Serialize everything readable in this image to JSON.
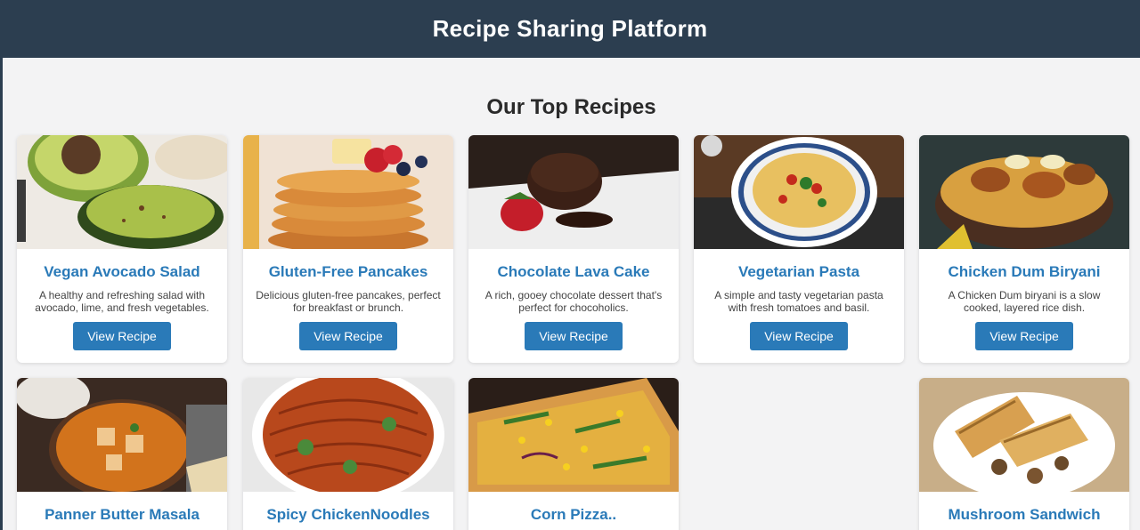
{
  "header": {
    "title": "Recipe Sharing Platform"
  },
  "section": {
    "title": "Our Top Recipes"
  },
  "recipes": [
    {
      "name": "Vegan Avocado Salad",
      "desc": "A healthy and refreshing salad with avocado, lime, and fresh vegetables.",
      "button": "View Recipe",
      "image": "avocado-salad-photo"
    },
    {
      "name": "Gluten-Free Pancakes",
      "desc": "Delicious gluten-free pancakes, perfect for breakfast or brunch.",
      "button": "View Recipe",
      "image": "pancakes-photo"
    },
    {
      "name": "Chocolate Lava Cake",
      "desc": "A rich, gooey chocolate dessert that's perfect for chocoholics.",
      "button": "View Recipe",
      "image": "lava-cake-photo"
    },
    {
      "name": "Vegetarian Pasta",
      "desc": "A simple and tasty vegetarian pasta with fresh tomatoes and basil.",
      "button": "View Recipe",
      "image": "pasta-photo"
    },
    {
      "name": "Chicken Dum Biryani",
      "desc": "A Chicken Dum biryani is a slow cooked, layered rice dish.",
      "button": "View Recipe",
      "image": "biryani-photo"
    },
    {
      "name": "Panner Butter Masala",
      "image": "paneer-masala-photo"
    },
    {
      "name": "Spicy ChickenNoodles",
      "image": "noodles-photo"
    },
    {
      "name": "Corn Pizza..",
      "image": "corn-pizza-photo"
    },
    {
      "name": "Mushroom Sandwich",
      "image": "mushroom-sandwich-photo"
    }
  ],
  "colors": {
    "header_bg": "#2c3e50",
    "accent": "#2a7ab8",
    "page_bg": "#f3f3f4"
  }
}
